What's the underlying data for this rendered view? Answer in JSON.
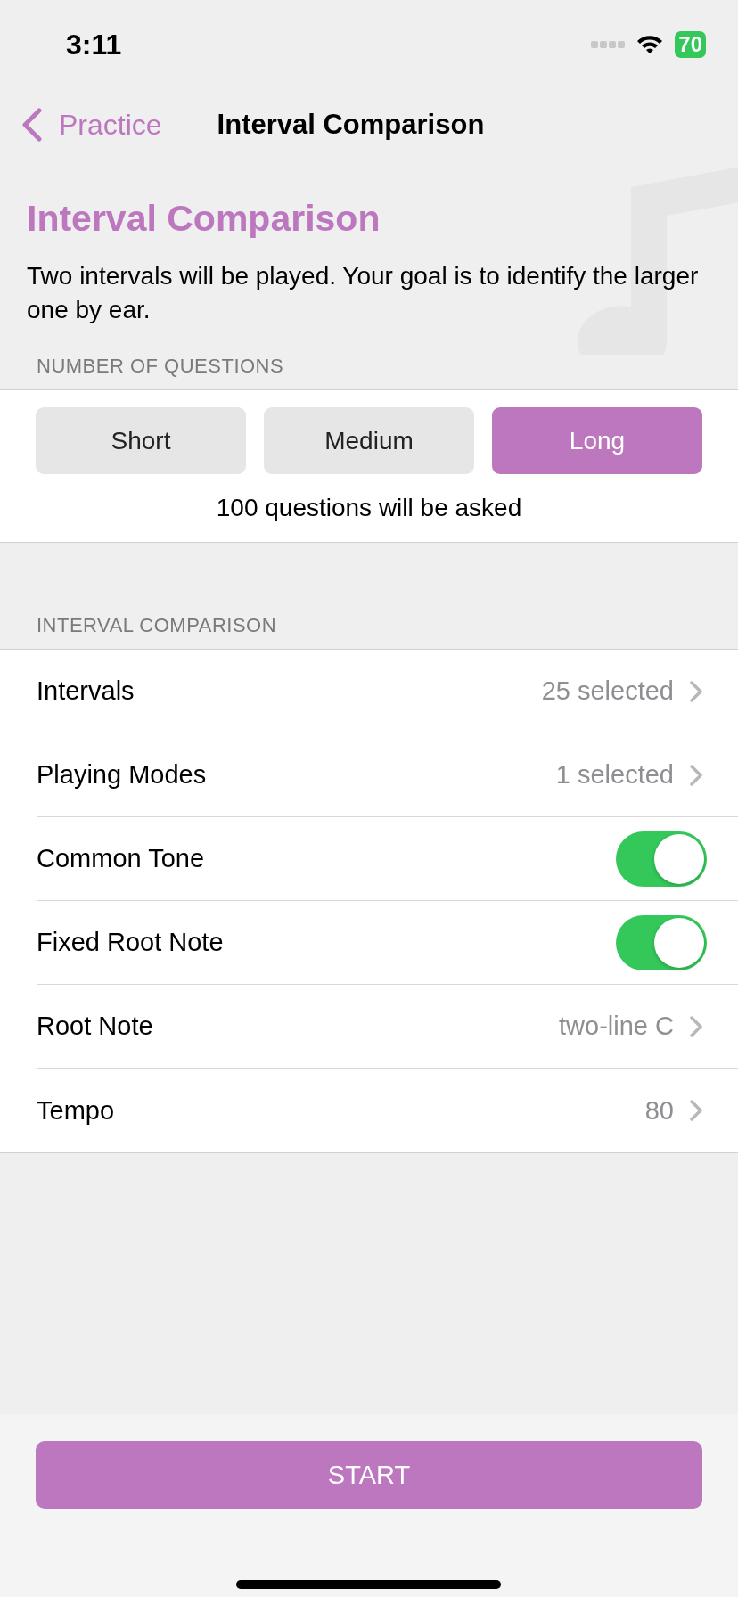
{
  "status_bar": {
    "time": "3:11",
    "battery": "70"
  },
  "nav": {
    "back": "Practice",
    "title": "Interval Comparison"
  },
  "header": {
    "title": "Interval Comparison",
    "description": "Two intervals will be played. Your goal is to identify the larger one by ear."
  },
  "questions": {
    "section_title": "NUMBER OF QUESTIONS",
    "options": [
      {
        "label": "Short",
        "selected": false
      },
      {
        "label": "Medium",
        "selected": false
      },
      {
        "label": "Long",
        "selected": true
      }
    ],
    "summary": "100 questions will be asked"
  },
  "settings": {
    "section_title": "INTERVAL COMPARISON",
    "rows": [
      {
        "kind": "disclosure",
        "label": "Intervals",
        "value": "25 selected"
      },
      {
        "kind": "disclosure",
        "label": "Playing Modes",
        "value": "1 selected"
      },
      {
        "kind": "toggle",
        "label": "Common Tone",
        "on": true
      },
      {
        "kind": "toggle",
        "label": "Fixed Root Note",
        "on": true
      },
      {
        "kind": "disclosure",
        "label": "Root Note",
        "value": "two-line C"
      },
      {
        "kind": "disclosure",
        "label": "Tempo",
        "value": "80"
      }
    ]
  },
  "start_button": "START"
}
